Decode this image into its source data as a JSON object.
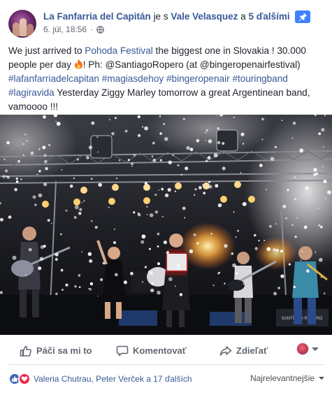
{
  "post": {
    "author": "La Fanfarria del Capitán",
    "with_prefix": "je s",
    "with_person": "Vale Velasquez",
    "with_conj": "a",
    "with_others": "5 ďalšími",
    "date": "6. júl, 18:56",
    "date_sep": "·",
    "icons": {
      "privacy": "globe-icon",
      "pinned": "pin-icon"
    },
    "text": {
      "t1": "We just arrived to ",
      "place": "Pohoda Festival",
      "t2": " the biggest one in Slovakia ! 30.000 people per day ",
      "emoji_icon": "fire-icon",
      "t3": "! Ph: @SantiagoRopero (at @bingeropenairfestival) ",
      "tags": [
        "#lafanfarriadelcapitan",
        "#magiasdehoy",
        "#bingeropenair",
        "#touringband",
        "#lagiravida"
      ],
      "t4": " Yesterday Ziggy Marley tomorrow a great Argentinean band, vamoooo !!!"
    },
    "photo": {
      "stage_sign": "SANTIAGO ROPERO"
    }
  },
  "actions": {
    "like": "Páči sa mi to",
    "comment": "Komentovať",
    "share": "Zdieľať",
    "icons": {
      "like": "thumbs-up-icon",
      "comment": "comment-icon",
      "share": "share-icon"
    }
  },
  "reactions": {
    "icons": [
      "like-reaction-icon",
      "love-reaction-icon"
    ],
    "names": "Valeria Chutrau, Peter Verček a 17 ďalších",
    "sort": "Najrelevantnejšie"
  },
  "colors": {
    "link": "#385898",
    "meta": "#616770",
    "like_blue": "#4267b2",
    "love_red": "#f0284a",
    "pin_blue": "#4080ff"
  }
}
